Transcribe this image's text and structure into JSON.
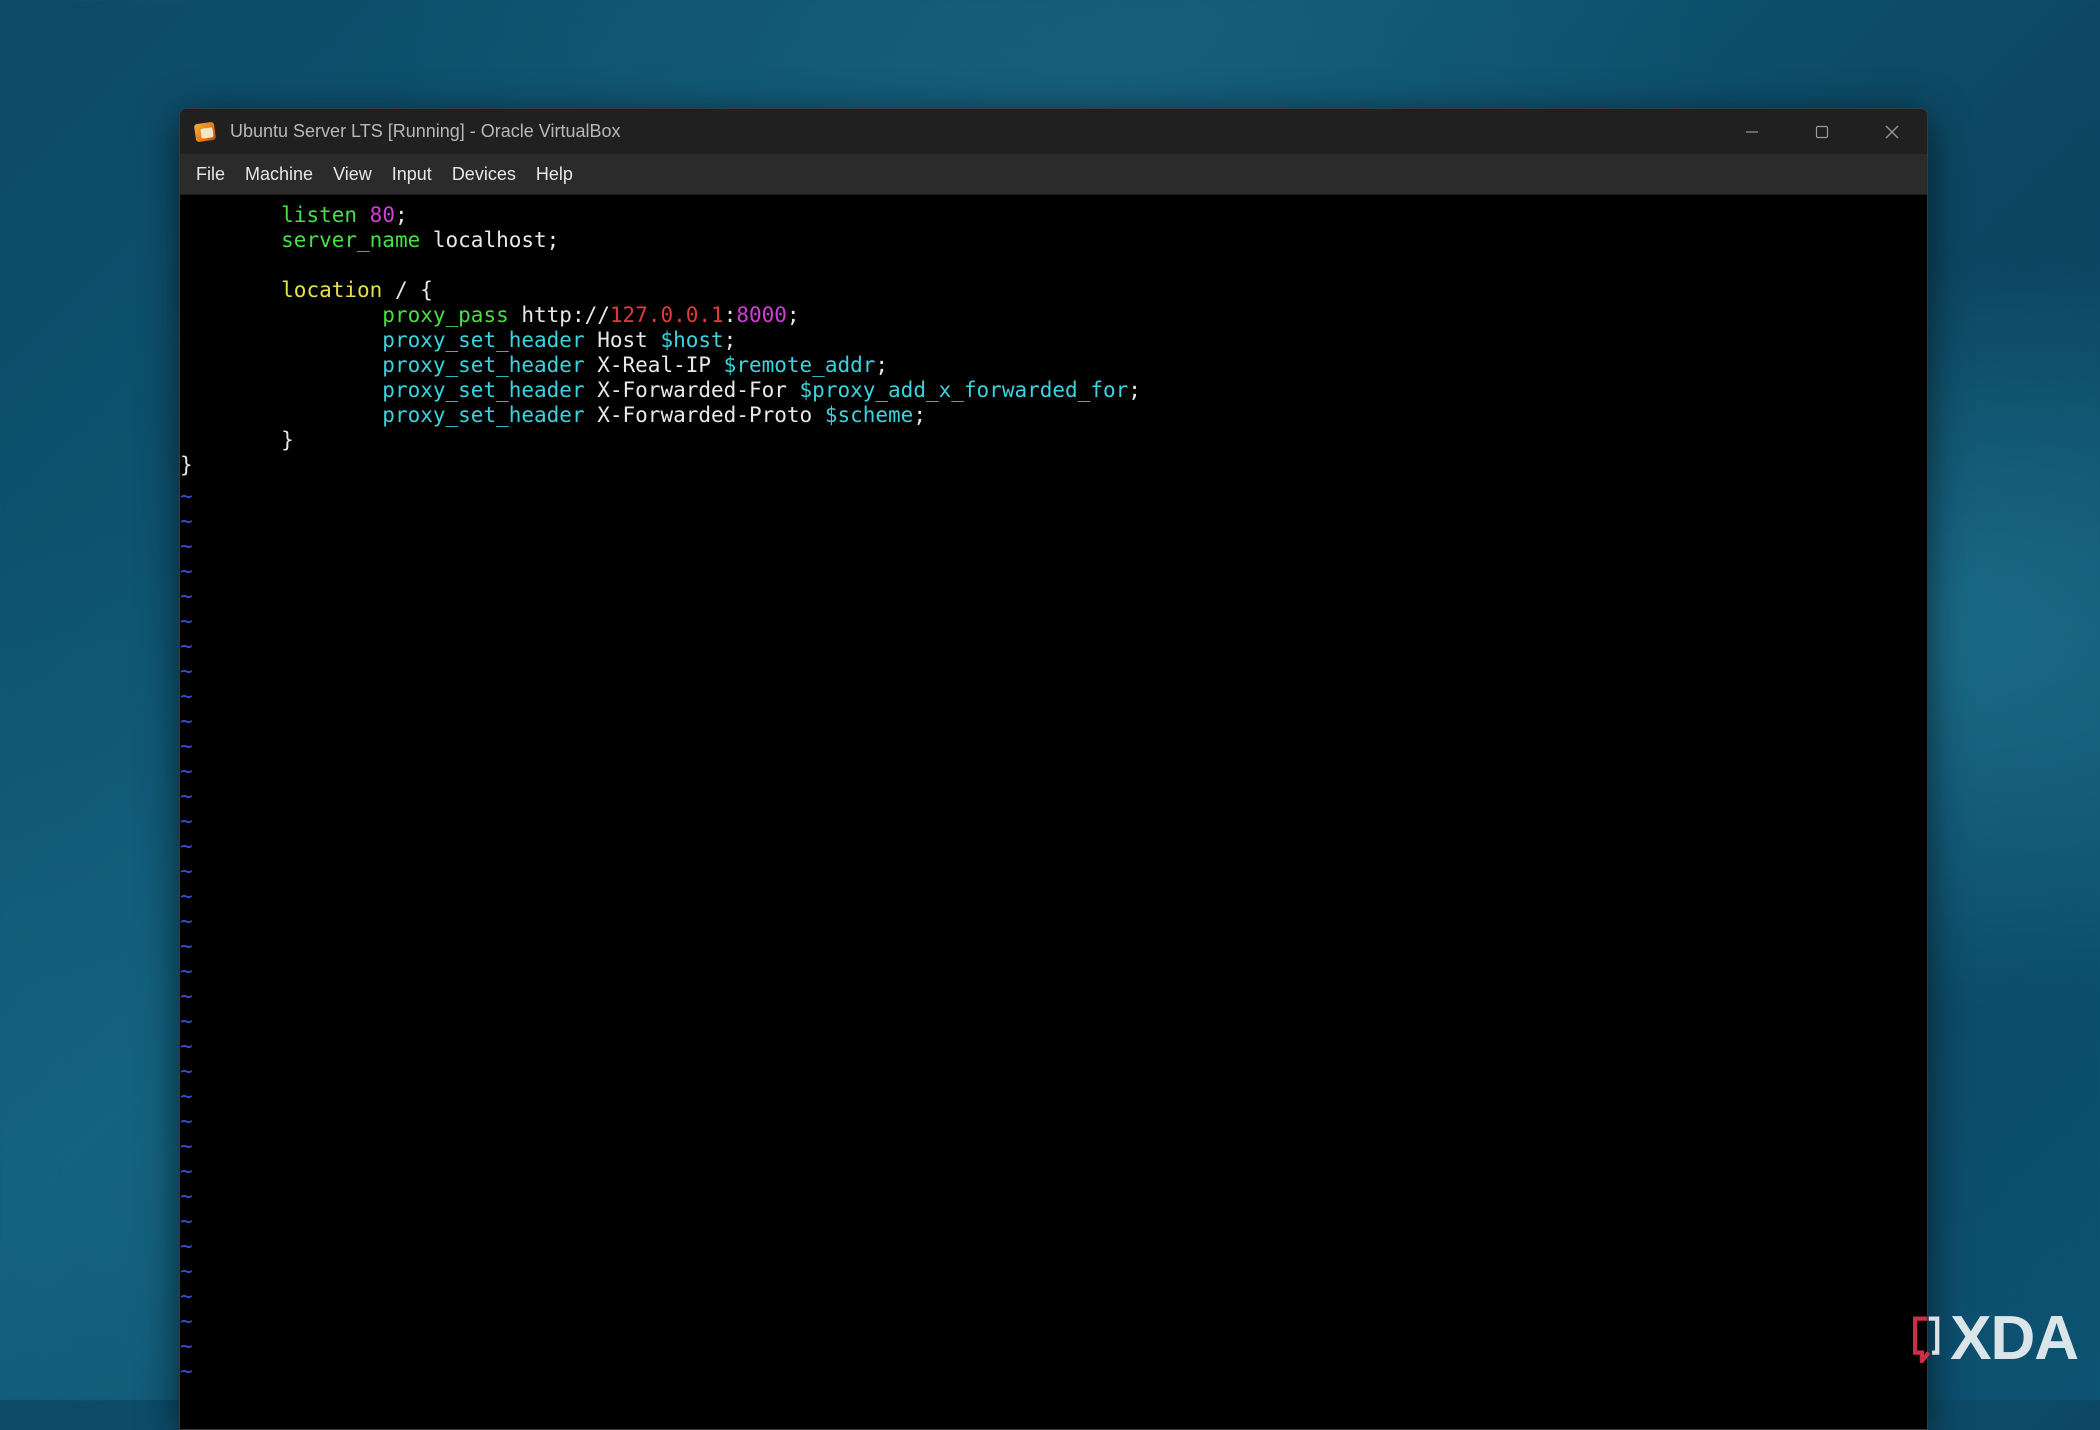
{
  "window": {
    "title": "Ubuntu Server LTS [Running] - Oracle VirtualBox",
    "app_icon": "virtualbox-icon"
  },
  "window_controls": [
    {
      "name": "minimize",
      "icon": "minimize-icon"
    },
    {
      "name": "maximize",
      "icon": "maximize-icon"
    },
    {
      "name": "close",
      "icon": "close-icon"
    }
  ],
  "menu": [
    "File",
    "Machine",
    "View",
    "Input",
    "Devices",
    "Help"
  ],
  "editor": {
    "lines": [
      [
        {
          "t": "        ",
          "c": "plain"
        },
        {
          "t": "listen",
          "c": "green"
        },
        {
          "t": " ",
          "c": "plain"
        },
        {
          "t": "80",
          "c": "magenta"
        },
        {
          "t": ";",
          "c": "plain"
        }
      ],
      [
        {
          "t": "        ",
          "c": "plain"
        },
        {
          "t": "server_name",
          "c": "green"
        },
        {
          "t": " localhost;",
          "c": "plain"
        }
      ],
      [],
      [
        {
          "t": "        ",
          "c": "plain"
        },
        {
          "t": "location",
          "c": "yellow"
        },
        {
          "t": " / {",
          "c": "plain"
        }
      ],
      [
        {
          "t": "                ",
          "c": "plain"
        },
        {
          "t": "proxy_pass",
          "c": "green"
        },
        {
          "t": " http://",
          "c": "plain"
        },
        {
          "t": "127.0.0.1",
          "c": "red"
        },
        {
          "t": ":",
          "c": "plain"
        },
        {
          "t": "8000",
          "c": "magenta"
        },
        {
          "t": ";",
          "c": "plain"
        }
      ],
      [
        {
          "t": "                ",
          "c": "plain"
        },
        {
          "t": "proxy_set_header",
          "c": "cyan"
        },
        {
          "t": " Host ",
          "c": "plain"
        },
        {
          "t": "$host",
          "c": "cyan"
        },
        {
          "t": ";",
          "c": "plain"
        }
      ],
      [
        {
          "t": "                ",
          "c": "plain"
        },
        {
          "t": "proxy_set_header",
          "c": "cyan"
        },
        {
          "t": " X-Real-IP ",
          "c": "plain"
        },
        {
          "t": "$remote_addr",
          "c": "cyan"
        },
        {
          "t": ";",
          "c": "plain"
        }
      ],
      [
        {
          "t": "                ",
          "c": "plain"
        },
        {
          "t": "proxy_set_header",
          "c": "cyan"
        },
        {
          "t": " X-Forwarded-For ",
          "c": "plain"
        },
        {
          "t": "$proxy_add_x_forwarded_for",
          "c": "cyan"
        },
        {
          "t": ";",
          "c": "plain"
        }
      ],
      [
        {
          "t": "                ",
          "c": "plain"
        },
        {
          "t": "proxy_set_header",
          "c": "cyan"
        },
        {
          "t": " X-Forwarded-Proto ",
          "c": "plain"
        },
        {
          "t": "$scheme",
          "c": "cyan"
        },
        {
          "t": ";",
          "c": "plain"
        }
      ],
      [
        {
          "t": "        }",
          "c": "plain"
        }
      ],
      [
        {
          "t": "}",
          "c": "plain"
        }
      ]
    ],
    "empty_line_marker": "~",
    "empty_line_count": 36
  },
  "watermark": {
    "text": "XDA",
    "icon": "xda-logo-icon"
  },
  "colors": {
    "green": "#44e044",
    "yellow": "#e8e050",
    "magenta": "#d040d0",
    "red": "#e23a3a",
    "cyan": "#3ad4e0",
    "tilde": "#3a52d8",
    "titlebar": "#202020",
    "menubar": "#2b2b2b"
  }
}
